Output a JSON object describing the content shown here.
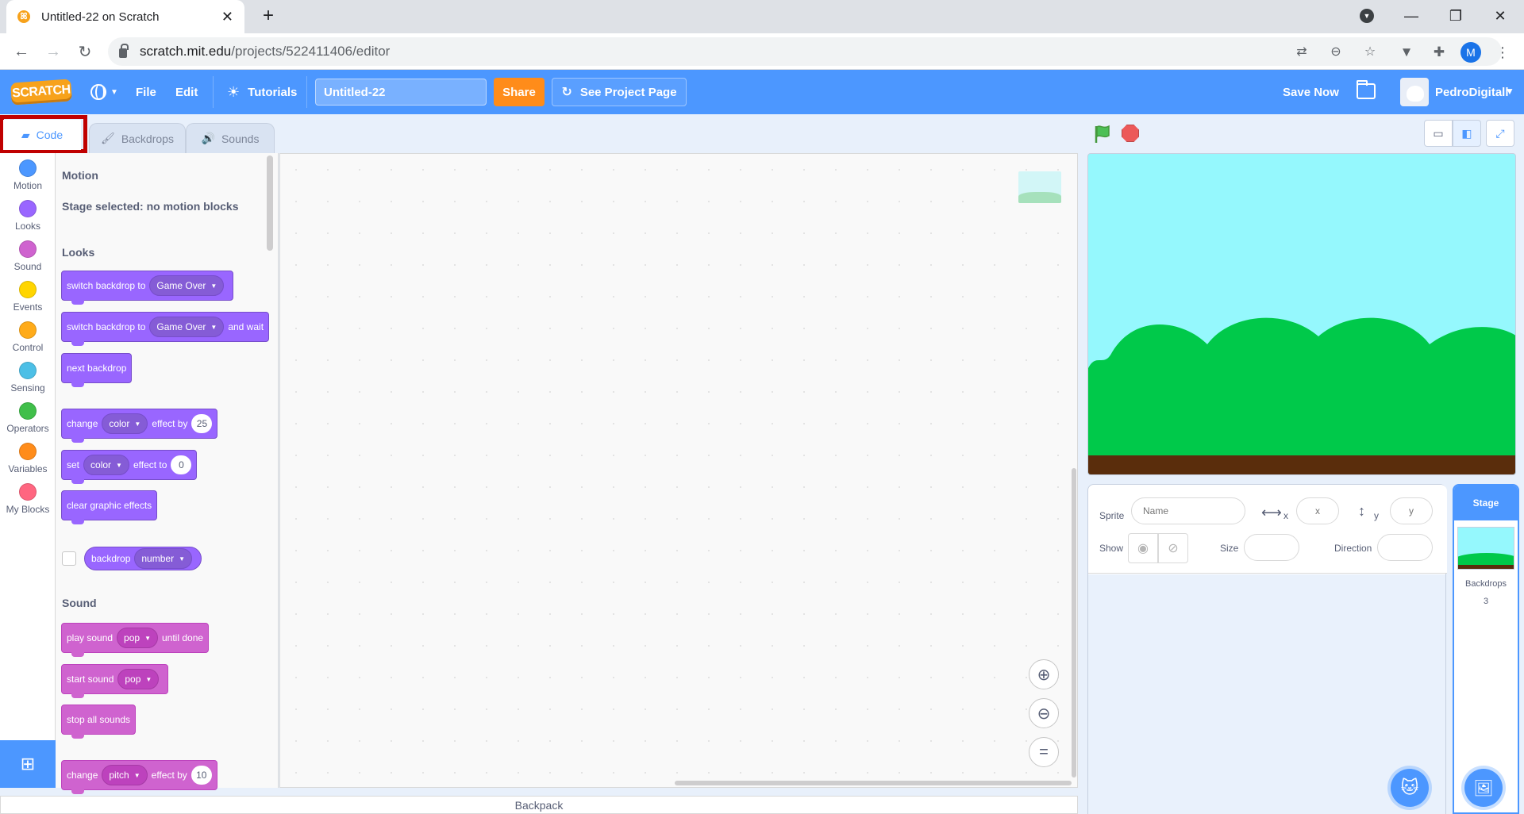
{
  "browser": {
    "tab_title": "Untitled-22 on Scratch",
    "tab_close": "✕",
    "new_tab": "+",
    "url_host": "scratch.mit.edu",
    "url_path": "/projects/522411406/editor",
    "profile_initial": "M"
  },
  "menubar": {
    "logo": "SCRATCH",
    "file": "File",
    "edit": "Edit",
    "tutorials": "Tutorials",
    "project_title": "Untitled-22",
    "share": "Share",
    "see_project_page": "See Project Page",
    "save_now": "Save Now",
    "username": "PedroDigitall"
  },
  "tabs": {
    "code": "Code",
    "backdrops": "Backdrops",
    "sounds": "Sounds"
  },
  "categories": [
    {
      "label": "Motion",
      "color": "#4c97ff"
    },
    {
      "label": "Looks",
      "color": "#9966ff"
    },
    {
      "label": "Sound",
      "color": "#cf63cf"
    },
    {
      "label": "Events",
      "color": "#ffd500"
    },
    {
      "label": "Control",
      "color": "#ffab19"
    },
    {
      "label": "Sensing",
      "color": "#4cbfe6"
    },
    {
      "label": "Operators",
      "color": "#40bf4a"
    },
    {
      "label": "Variables",
      "color": "#ff8c1a"
    },
    {
      "label": "My Blocks",
      "color": "#ff6680"
    }
  ],
  "palette": {
    "motion_heading": "Motion",
    "motion_note": "Stage selected: no motion blocks",
    "looks_heading": "Looks",
    "sound_heading": "Sound",
    "blocks": {
      "switch_backdrop": {
        "text": "switch backdrop to",
        "value": "Game Over"
      },
      "switch_backdrop_wait": {
        "text": "switch backdrop to",
        "value": "Game Over",
        "suffix": "and wait"
      },
      "next_backdrop": {
        "text": "next backdrop"
      },
      "change_effect": {
        "text": "change",
        "value": "color",
        "mid": "effect by",
        "num": "25"
      },
      "set_effect": {
        "text": "set",
        "value": "color",
        "mid": "effect to",
        "num": "0"
      },
      "clear_effects": {
        "text": "clear graphic effects"
      },
      "backdrop_reporter": {
        "text": "backdrop",
        "value": "number"
      },
      "play_sound": {
        "text": "play sound",
        "value": "pop",
        "suffix": "until done"
      },
      "start_sound": {
        "text": "start sound",
        "value": "pop"
      },
      "stop_sounds": {
        "text": "stop all sounds"
      },
      "change_pitch": {
        "text": "change",
        "value": "pitch",
        "mid": "effect by",
        "num": "10"
      }
    }
  },
  "backpack": "Backpack",
  "sprite_info": {
    "sprite_label": "Sprite",
    "name_placeholder": "Name",
    "x_label": "x",
    "x_placeholder": "x",
    "y_label": "y",
    "y_placeholder": "y",
    "show_label": "Show",
    "size_label": "Size",
    "direction_label": "Direction"
  },
  "stage_target": {
    "title": "Stage",
    "backdrops_label": "Backdrops",
    "backdrops_count": "3"
  },
  "colors": {
    "scratch_blue": "#4c97ff",
    "share_orange": "#ff8c1a",
    "highlight_frame": "#c00000",
    "sky": "#95f8fd",
    "hills": "#00c94a",
    "ground": "#5a2d0c"
  },
  "icons": [
    "globe-icon",
    "bulb-icon",
    "remix-icon",
    "folder-icon",
    "green-flag-icon",
    "stop-icon",
    "zoom-in-icon",
    "zoom-out-icon",
    "zoom-reset-icon",
    "add-extension-icon",
    "add-sprite-icon",
    "add-backdrop-icon"
  ]
}
